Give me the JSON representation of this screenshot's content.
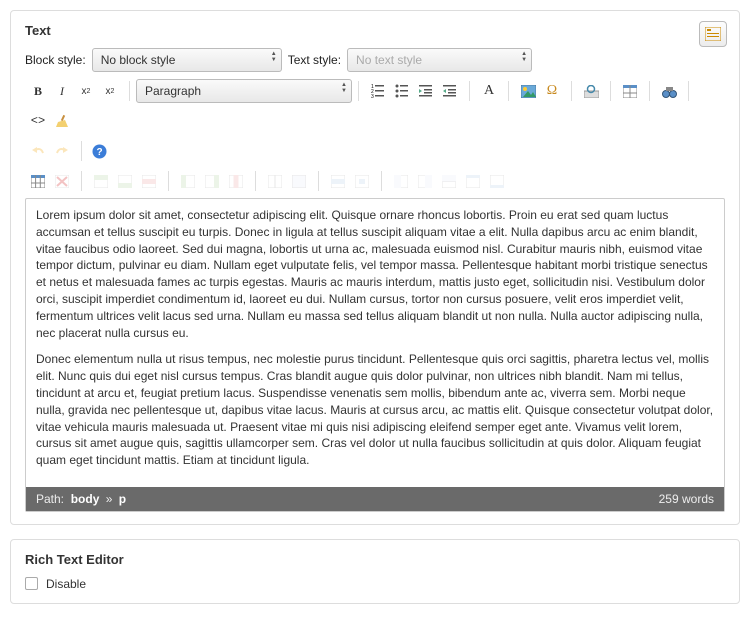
{
  "panel1": {
    "title": "Text",
    "block_style_label": "Block style:",
    "block_style_value": "No block style",
    "text_style_label": "Text style:",
    "text_style_value": "No text style",
    "format_value": "Paragraph",
    "font_family_letter": "A",
    "body_p1": "Lorem ipsum dolor sit amet, consectetur adipiscing elit. Quisque ornare rhoncus lobortis. Proin eu erat sed quam luctus accumsan et tellus suscipit eu turpis. Donec in ligula at tellus suscipit aliquam vitae a elit. Nulla dapibus arcu ac enim blandit, vitae faucibus odio laoreet. Sed dui magna, lobortis ut urna ac, malesuada euismod nisl. Curabitur mauris nibh, euismod vitae tempor dictum, pulvinar eu diam. Nullam eget vulputate felis, vel tempor massa. Pellentesque habitant morbi tristique senectus et netus et malesuada fames ac turpis egestas. Mauris ac mauris interdum, mattis justo eget, sollicitudin nisi. Vestibulum dolor orci, suscipit imperdiet condimentum id, laoreet eu dui. Nullam cursus, tortor non cursus posuere, velit eros imperdiet velit, fermentum ultrices velit lacus sed urna. Nullam eu massa sed tellus aliquam blandit ut non nulla. Nulla auctor adipiscing nulla, nec placerat nulla cursus eu.",
    "body_p2": "Donec elementum nulla ut risus tempus, nec molestie purus tincidunt. Pellentesque quis orci sagittis, pharetra lectus vel, mollis elit. Nunc quis dui eget nisl cursus tempus. Cras blandit augue quis dolor pulvinar, non ultrices nibh blandit. Nam mi tellus, tincidunt at arcu et, feugiat pretium lacus. Suspendisse venenatis sem mollis, bibendum ante ac, viverra sem. Morbi neque nulla, gravida nec pellentesque ut, dapibus vitae lacus. Mauris at cursus arcu, ac mattis elit. Quisque consectetur volutpat dolor, vitae vehicula mauris malesuada ut. Praesent vitae mi quis nisi adipiscing eleifend semper eget ante. Vivamus velit lorem, cursus sit amet augue quis, sagittis ullamcorper sem. Cras vel dolor ut nulla faucibus sollicitudin at quis dolor. Aliquam feugiat quam eget tincidunt mattis. Etiam at tincidunt ligula.",
    "path_label": "Path:",
    "path_body": "body",
    "path_sep": "»",
    "path_p": "p",
    "word_count": "259 words"
  },
  "panel2": {
    "title": "Rich Text Editor",
    "disable_label": "Disable"
  }
}
